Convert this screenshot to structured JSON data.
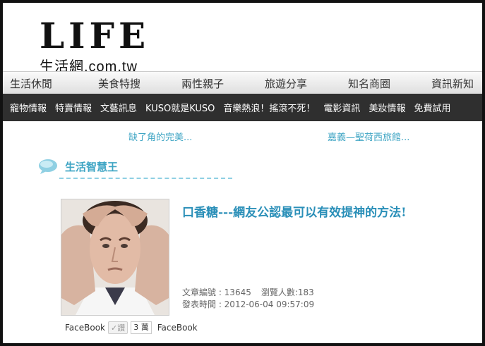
{
  "logo": {
    "main": "LIFE",
    "sub": "生活網",
    "domain": ".com.tw"
  },
  "main_nav": [
    "生活休閒",
    "美食特搜",
    "兩性親子",
    "旅遊分享",
    "知名商圈",
    "資訊新知"
  ],
  "sub_nav": [
    "寵物情報",
    "特賣情報",
    "文藝訊息",
    "KUSO就是KUSO",
    "音樂熱浪！搖滾不死！",
    "電影資訊",
    "美妝情報",
    "免費試用"
  ],
  "related": {
    "left": "缺了角的完美...",
    "right": "嘉義—聖荷西旅館..."
  },
  "section": {
    "title": "生活智慧王"
  },
  "article": {
    "title": "口香糖---網友公認最可以有效提神的方法!",
    "id_label": "文章編號 : 13645",
    "views_label": "瀏覽人數:183",
    "date_label": "發表時間 : 2012-06-04 09:57:09"
  },
  "social": {
    "fb_label": "FaceBook",
    "like_label": "讚",
    "like_count": "3 萬",
    "fb_label2": "FaceBook"
  },
  "colors": {
    "accent": "#3fa5c4",
    "title": "#2a8fb8",
    "subnav_bg": "#2f2f2f"
  }
}
